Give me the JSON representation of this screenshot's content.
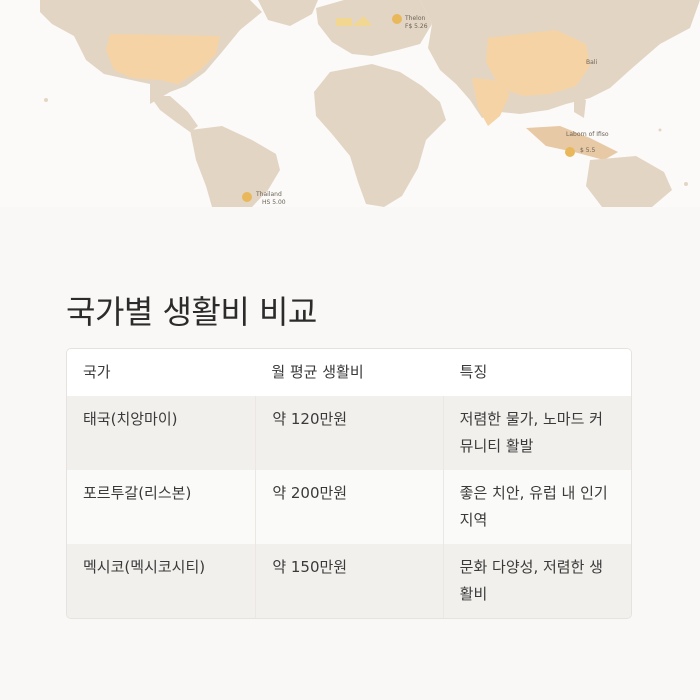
{
  "map": {
    "pins": [
      {
        "name": "Thelon",
        "price": "F$ 5.26"
      },
      {
        "name": "Bali",
        "price": ""
      },
      {
        "name": "Laborn of Ifiso",
        "price": "$ 5.5"
      },
      {
        "name": "Thailand",
        "price": "HS 5.00"
      }
    ],
    "colors": {
      "land": "#e3d5c4",
      "highlight": "#f6d3a4",
      "water": "#fbfaf8",
      "pin": "#e8b85a"
    }
  },
  "page": {
    "title": "국가별 생활비 비교"
  },
  "table": {
    "headers": [
      "국가",
      "월 평균 생활비",
      "특징"
    ],
    "rows": [
      {
        "country": "태국(치앙마이)",
        "cost": "약 120만원",
        "feature": "저렴한 물가, 노마드 커뮤니티 활발"
      },
      {
        "country": "포르투갈(리스본)",
        "cost": "약 200만원",
        "feature": "좋은 치안, 유럽 내 인기 지역"
      },
      {
        "country": "멕시코(멕시코시티)",
        "cost": "약 150만원",
        "feature": "문화 다양성, 저렴한 생활비"
      }
    ]
  }
}
